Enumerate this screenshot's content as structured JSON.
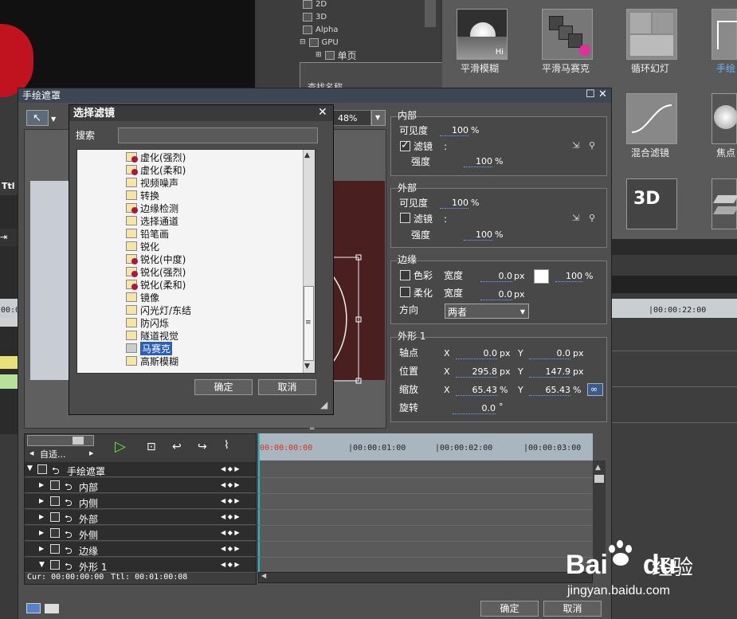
{
  "background": {
    "preview_label": "Ttl",
    "tree": [
      "2D",
      "3D",
      "Alpha",
      "GPU",
      "单页"
    ],
    "effects": [
      {
        "label": "平滑模糊",
        "badge": "Hi"
      },
      {
        "label": "平滑马赛克",
        "badge": ""
      },
      {
        "label": "循环幻灯",
        "badge": ""
      },
      {
        "label": "手绘",
        "badge": ""
      },
      {
        "label": "混合滤镜",
        "badge": ""
      },
      {
        "label": "焦点",
        "badge": ""
      },
      {
        "label": "",
        "badge": "3D"
      }
    ],
    "small_panel_label": "查找名称"
  },
  "window": {
    "title": "手绘遮罩",
    "zoom": "48%",
    "ok": "确定",
    "cancel": "取消"
  },
  "inner": {
    "title": "内部",
    "visibility_label": "可见度",
    "visibility_value": "100",
    "filter_label": "滤镜",
    "filter_value": ":",
    "strength_label": "强度",
    "strength_value": "100",
    "percent": "%"
  },
  "outer": {
    "title": "外部",
    "visibility_label": "可见度",
    "visibility_value": "100",
    "filter_label": "滤镜",
    "filter_value": ":",
    "strength_label": "强度",
    "strength_value": "100",
    "percent": "%"
  },
  "edge": {
    "title": "边缘",
    "color_label": "色彩",
    "width_label": "宽度",
    "color_width": "0.0",
    "px": "px",
    "color_opacity": "100",
    "percent": "%",
    "soften_label": "柔化",
    "soften_width": "0.0",
    "direction_label": "方向",
    "direction_value": "两者",
    "white_color": "#ffffff"
  },
  "shape": {
    "title": "外形 1",
    "pivot_label": "轴点",
    "pivot_x": "0.0",
    "pivot_y": "0.0",
    "position_label": "位置",
    "position_x": "295.8",
    "position_y": "147.9",
    "scale_label": "缩放",
    "scale_x": "65.43",
    "scale_y": "65.43",
    "rotation_label": "旋转",
    "rotation_value": "0.0",
    "x": "X",
    "y": "Y",
    "px": "px",
    "percent": "%",
    "deg": "°"
  },
  "dialog": {
    "title": "选择滤镜",
    "search_label": "搜索",
    "search_value": "",
    "items": [
      {
        "label": "虚化(强烈)",
        "fx": true
      },
      {
        "label": "虚化(柔和)",
        "fx": true
      },
      {
        "label": "视频噪声",
        "fx": false
      },
      {
        "label": "转换",
        "fx": false
      },
      {
        "label": "边缘检测",
        "fx": true
      },
      {
        "label": "选择通道",
        "fx": false
      },
      {
        "label": "铅笔画",
        "fx": false
      },
      {
        "label": "锐化",
        "fx": false
      },
      {
        "label": "锐化(中度)",
        "fx": true
      },
      {
        "label": "锐化(强烈)",
        "fx": true
      },
      {
        "label": "锐化(柔和)",
        "fx": true
      },
      {
        "label": "镜像",
        "fx": false
      },
      {
        "label": "闪光灯/东结",
        "fx": false
      },
      {
        "label": "防闪烁",
        "fx": false
      },
      {
        "label": "隧道视觉",
        "fx": false
      },
      {
        "label": "马赛克",
        "fx": false,
        "selected": true
      },
      {
        "label": "高斯模糊",
        "fx": false
      }
    ],
    "ok": "确定",
    "cancel": "取消"
  },
  "timeline": {
    "mode": "自适...",
    "tracks": [
      "手绘遮罩",
      "内部",
      "内侧",
      "外部",
      "外侧",
      "边缘",
      "外形 1"
    ],
    "ruler": [
      "00:00:00:00",
      "|00:00:01:00",
      "|00:00:02:00",
      "|00:00:03:00"
    ],
    "bg_ruler": [
      "|00:00:22:00",
      "00:0"
    ],
    "cur": "Cur: 00:00:00:00",
    "ttl": "Ttl: 00:01:00:08"
  },
  "watermark": {
    "brand": "Bai",
    "brand2": "du",
    "jingyan": "经验",
    "url": "jingyan.baidu.com"
  }
}
